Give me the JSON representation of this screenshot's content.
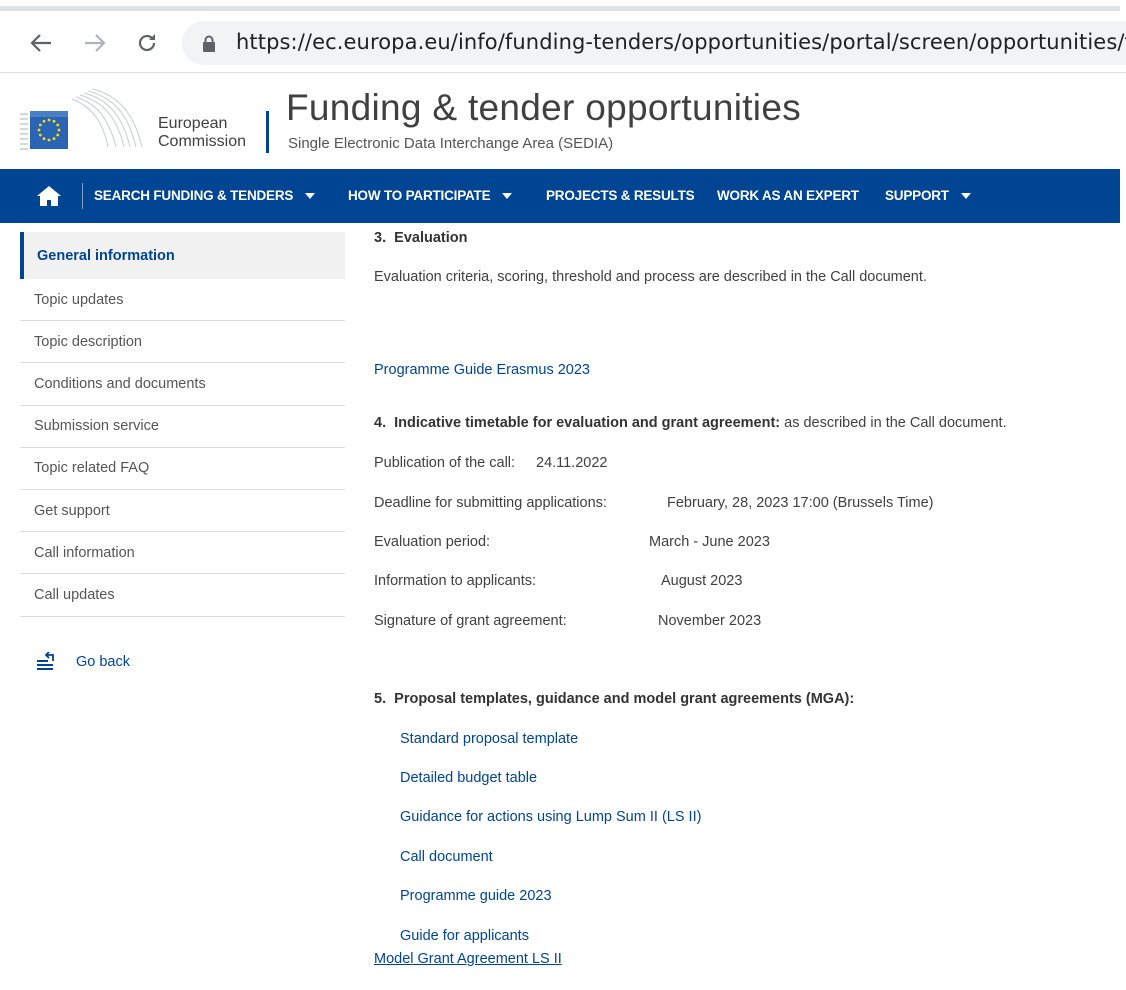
{
  "browser": {
    "url": "https://ec.europa.eu/info/funding-tenders/opportunities/portal/screen/opportunities/top",
    "icons": [
      "back-arrow-icon",
      "forward-arrow-icon",
      "reload-icon",
      "lock-icon"
    ]
  },
  "header": {
    "logo_line1": "European",
    "logo_line2": "Commission",
    "title": "Funding & tender opportunities",
    "subtitle": "Single Electronic Data Interchange Area (SEDIA)"
  },
  "nav": {
    "items": [
      {
        "label": "SEARCH FUNDING & TENDERS",
        "dropdown": true
      },
      {
        "label": "HOW TO PARTICIPATE",
        "dropdown": true
      },
      {
        "label": "PROJECTS & RESULTS",
        "dropdown": false
      },
      {
        "label": "WORK AS AN EXPERT",
        "dropdown": false
      },
      {
        "label": "SUPPORT",
        "dropdown": true
      }
    ],
    "color": "#004494"
  },
  "sidebar": {
    "items": [
      {
        "label": "General information",
        "active": true
      },
      {
        "label": "Topic updates"
      },
      {
        "label": "Topic description"
      },
      {
        "label": "Conditions and documents"
      },
      {
        "label": "Submission service"
      },
      {
        "label": "Topic related FAQ"
      },
      {
        "label": "Get support"
      },
      {
        "label": "Call information"
      },
      {
        "label": "Call updates"
      }
    ],
    "go_back": "Go back"
  },
  "main": {
    "evaluation": {
      "number": "3.",
      "title": "Evaluation",
      "text": "Evaluation criteria, scoring, threshold and process are described in the Call document.",
      "link": "Programme Guide Erasmus 2023"
    },
    "timetable": {
      "number": "4.",
      "title": "Indicative timetable for evaluation and grant agreement:",
      "suffix": "as described in the Call document.",
      "rows": [
        {
          "label": "Publication of the call:",
          "value": "24.11.2022"
        },
        {
          "label": "Deadline for submitting applications:",
          "value": "February, 28, 2023 17:00 (Brussels Time)"
        },
        {
          "label": "Evaluation period:",
          "value": "March - June 2023"
        },
        {
          "label": "Information to applicants:",
          "value": "August 2023"
        },
        {
          "label": "Signature of grant agreement:",
          "value": "November 2023"
        }
      ]
    },
    "templates": {
      "number": "5.",
      "title": "Proposal templates, guidance and model grant agreements (MGA):",
      "links": [
        "Standard proposal template",
        "Detailed budget table",
        "Guidance for actions using Lump Sum II (LS II)",
        "Call document",
        "Programme guide 2023",
        "Guide for applicants"
      ],
      "mga_link": "Model Grant Agreement LS II"
    }
  }
}
